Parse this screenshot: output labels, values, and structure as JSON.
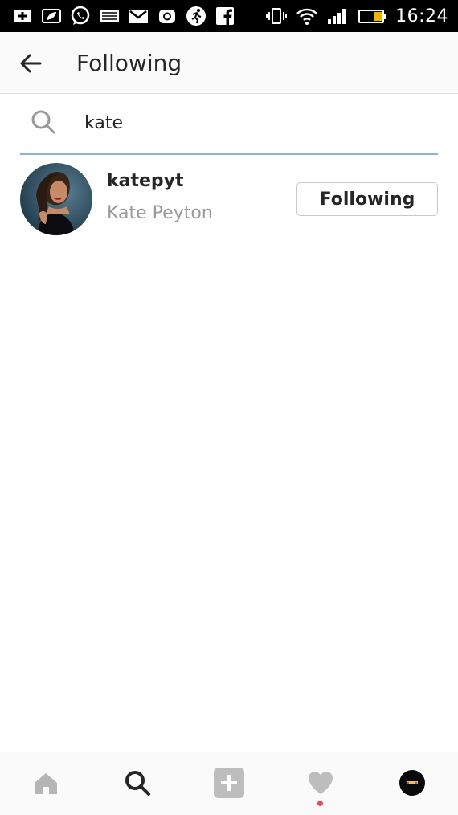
{
  "status_bar": {
    "time": "16:24",
    "icons": [
      "add-box-icon",
      "leaf-icon",
      "whatsapp-icon",
      "message-icon",
      "gmail-icon",
      "camera-icon",
      "runner-icon",
      "facebook-icon",
      "vibrate-icon",
      "wifi-icon",
      "signal-icon",
      "battery-icon"
    ]
  },
  "header": {
    "back_icon": "arrow-left-icon",
    "title": "Following"
  },
  "search": {
    "icon": "search-icon",
    "value": "kate"
  },
  "results": [
    {
      "username": "katepyt",
      "full_name": "Kate Peyton",
      "button_label": "Following"
    }
  ],
  "bottom_nav": {
    "items": [
      "home-icon",
      "search-icon",
      "add-icon",
      "heart-icon",
      "profile-avatar"
    ],
    "active": "search-icon",
    "notification_dot_color": "#ed4956"
  }
}
